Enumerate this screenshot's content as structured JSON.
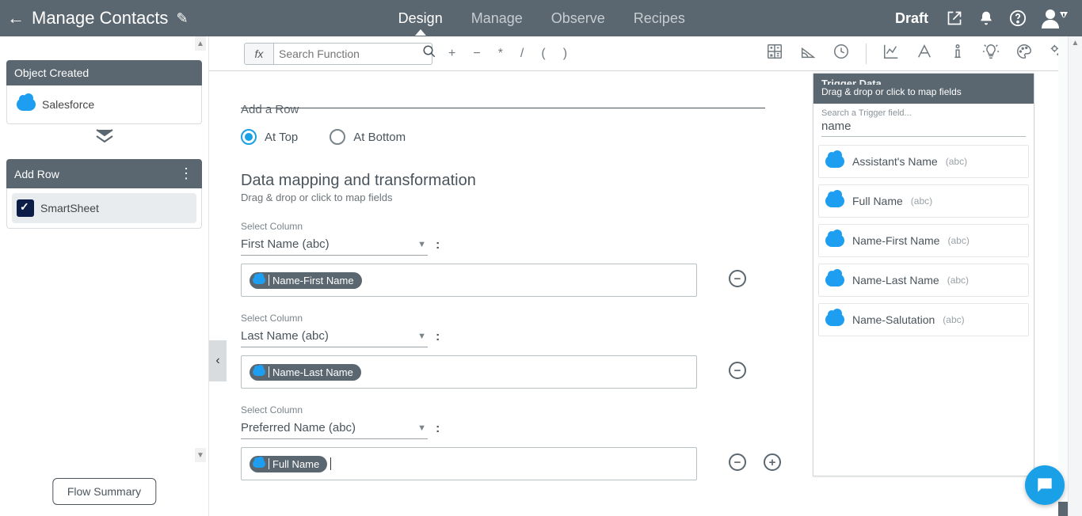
{
  "header": {
    "title": "Manage Contacts",
    "status": "Draft",
    "tabs": [
      "Design",
      "Manage",
      "Observe",
      "Recipes"
    ],
    "active_tab": 0
  },
  "sidebar": {
    "trigger_section": "Object Created",
    "trigger_item": "Salesforce",
    "action_section": "Add Row",
    "action_item": "SmartSheet",
    "flow_summary_btn": "Flow Summary"
  },
  "fnbar": {
    "fx": "fx",
    "search_placeholder": "Search Function",
    "ops": [
      "+",
      "−",
      "*",
      "/",
      "(",
      ")"
    ]
  },
  "canvas": {
    "add_row_label": "Add a Row",
    "radio_top": "At Top",
    "radio_bottom": "At Bottom",
    "section_title": "Data mapping and transformation",
    "section_sub": "Drag & drop or click to map fields",
    "select_column_label": "Select Column",
    "mappings": [
      {
        "column": "First Name (abc)",
        "chip": "Name-First Name"
      },
      {
        "column": "Last Name (abc)",
        "chip": "Name-Last Name"
      },
      {
        "column": "Preferred Name (abc)",
        "chip": "Full Name"
      }
    ]
  },
  "tdata": {
    "title": "Trigger Data",
    "subtitle": "Drag & drop or click to map fields",
    "search_label": "Search a Trigger field...",
    "search_value": "name",
    "type_hint": "(abc)",
    "fields": [
      "Assistant's Name",
      "Full Name",
      "Name-First Name",
      "Name-Last Name",
      "Name-Salutation"
    ]
  }
}
